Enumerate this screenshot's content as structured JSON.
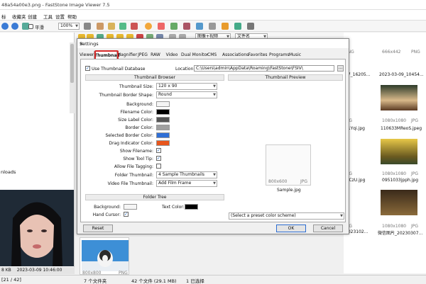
{
  "window": {
    "title": "48a54a00e3.png - FastStone Image Viewer 7.5"
  },
  "menu": [
    "标",
    "收藏夹",
    "创建",
    "工具",
    "设置",
    "帮助"
  ],
  "toolbar": {
    "smooth_label": "平滑",
    "zoom": "100%",
    "sort": "图像+视频",
    "sortby": "文件名"
  },
  "leftpanel": {
    "downloads": "nloads"
  },
  "preview": {
    "size": "8 KB",
    "date": "2023-03-09 10:46:00"
  },
  "thumbs": [
    {
      "label": "666x442",
      "type": "PNG"
    },
    {
      "label": "2023-03-09_10454...",
      "type": ""
    },
    {
      "label": "1080x1080",
      "type": "JPG"
    },
    {
      "label": "110633MReoS.jpeg",
      "type": ""
    },
    {
      "label": "1080x1080",
      "type": "JPG"
    },
    {
      "label": "0951033jpph.jpg",
      "type": ""
    },
    {
      "label": "1080x1080",
      "type": "JPG"
    },
    {
      "label": "微信图片_20230307...",
      "type": ""
    }
  ],
  "bg_labels": {
    "a": "PNG",
    "b": "07_16205...",
    "c": "JPG",
    "d": "01Yqi.jpg",
    "e": "JPG",
    "f": "0lCzU.jpg",
    "g": "JPG",
    "h": "2023102..."
  },
  "bottom_thumb": {
    "size": "800x800",
    "type": "PNG"
  },
  "status": {
    "page": "[21 / 42]",
    "folders": "7 个文件夹",
    "files": "42 个文件 (29.1 MB)",
    "selected": "1 已选择"
  },
  "dialog": {
    "title": "Settings",
    "tabs": [
      "Viewer",
      "Thumbnail",
      "Magnifier",
      "JPEG",
      "RAW",
      "Video",
      "Dual Monitor",
      "CMS",
      "Associations",
      "Favorites",
      "Programs",
      "Music"
    ],
    "use_db_label": "Use Thumbnail Database",
    "location_label": "Location:",
    "location_value": "C:\\Users\\admin\\AppData\\Roaming\\FastStone\\FSIV\\",
    "browse": "...",
    "browser_section": "Thumbnail Browser",
    "preview_section": "Thumbnail Preview",
    "size_label": "Thumbnail Size:",
    "size_value": "120 x 90",
    "shape_label": "Thumbnail Border Shape:",
    "shape_value": "Round",
    "background_label": "Background:",
    "filename_color_label": "Filename Color:",
    "sizelabel_color_label": "Size Label Color:",
    "border_color_label": "Border Color:",
    "sel_border_color_label": "Selected Border Color:",
    "drag_color_label": "Drag Indicator Color:",
    "show_filename_label": "Show Filename:",
    "show_tooltip_label": "Show Tool Tip:",
    "allow_tagging_label": "Allow File Tagging:",
    "folder_thumb_label": "Folder Thumbnail:",
    "folder_thumb_value": "4 Sample Thumbnails",
    "video_thumb_label": "Video File Thumbnail:",
    "video_thumb_value": "Add Film Frame",
    "folder_tree_section": "Folder Tree",
    "tree_bg_label": "Background:",
    "text_color_label": "Text Color:",
    "hand_cursor_label": "Hand Cursor:",
    "sample_size": "800x600",
    "sample_type": "JPG",
    "sample_name": "Sample.jpg",
    "preset_value": "(Select a preset color scheme)",
    "reset": "Reset",
    "ok": "OK",
    "cancel": "Cancel",
    "colors": {
      "background": "#f5f5f5",
      "filename": "#000000",
      "sizelabel": "#555555",
      "border": "#a0a0a0",
      "selected": "#2f6fd6",
      "drag": "#e8561c",
      "text": "#000000"
    }
  }
}
